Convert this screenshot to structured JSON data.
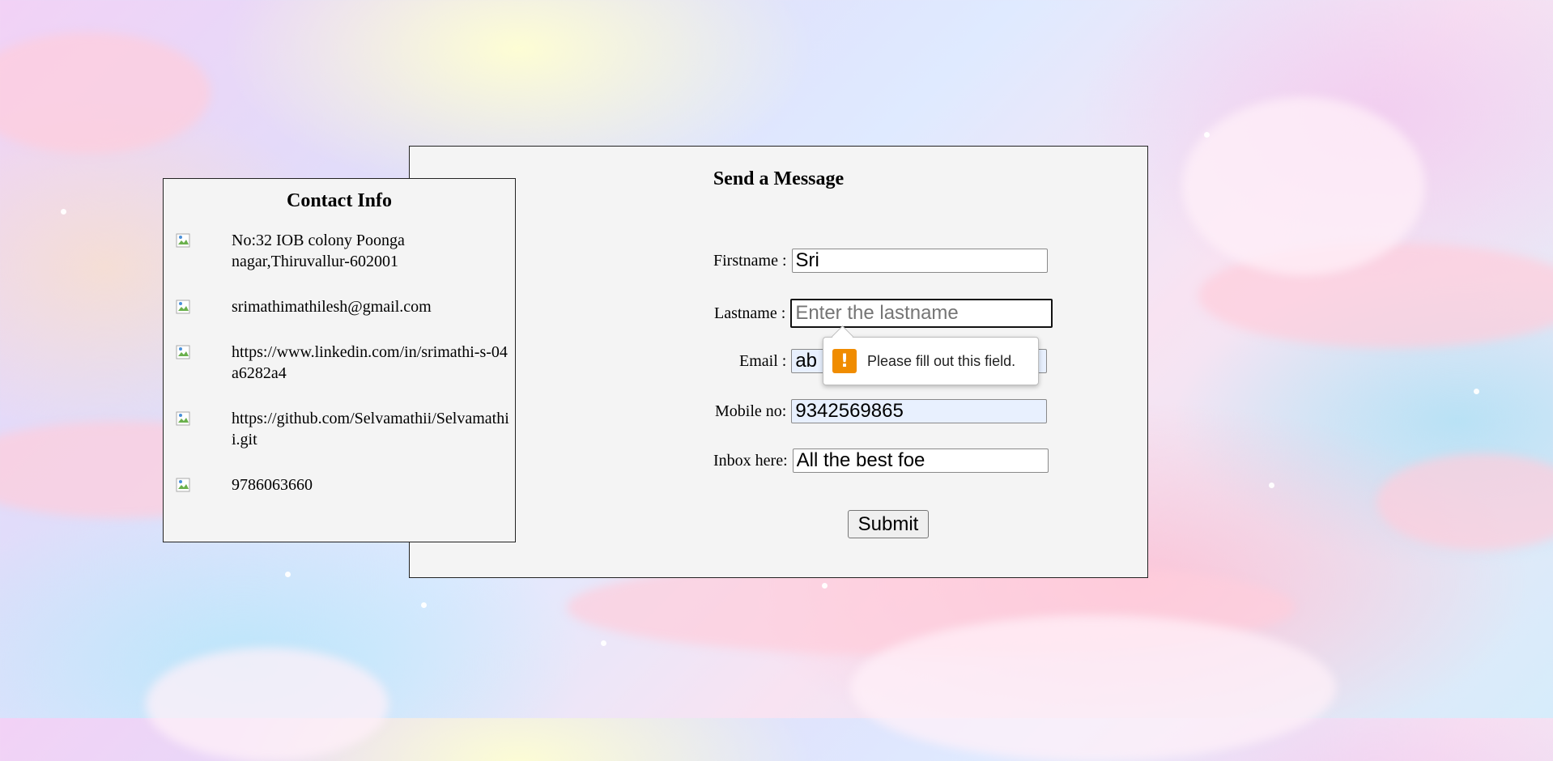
{
  "contact": {
    "title": "Contact Info",
    "items": [
      {
        "icon": "broken-image-icon",
        "text": "No:32 IOB colony Poonga nagar,Thiruvallur-602001"
      },
      {
        "icon": "broken-image-icon",
        "text": "srimathimathilesh@gmail.com"
      },
      {
        "icon": "broken-image-icon",
        "text": "https://www.linkedin.com/in/srimathi-s-04a6282a4"
      },
      {
        "icon": "broken-image-icon",
        "text": "https://github.com/Selvamathii/Selvamathii.git"
      },
      {
        "icon": "broken-image-icon",
        "text": "9786063660"
      }
    ]
  },
  "message": {
    "title": "Send a Message",
    "fields": {
      "firstname": {
        "label": "Firstname :",
        "value": "Sri",
        "placeholder": ""
      },
      "lastname": {
        "label": "Lastname :",
        "value": "",
        "placeholder": "Enter the lastname"
      },
      "email": {
        "label": "Email :",
        "value": "ab",
        "placeholder": ""
      },
      "mobile": {
        "label": "Mobile no:",
        "value": "9342569865",
        "placeholder": ""
      },
      "inbox": {
        "label": "Inbox here:",
        "value": "All the best foe",
        "placeholder": ""
      }
    },
    "submit_label": "Submit"
  },
  "validation": {
    "icon": "warning-icon",
    "message": "Please fill out this field.",
    "color": "#f08c00"
  }
}
